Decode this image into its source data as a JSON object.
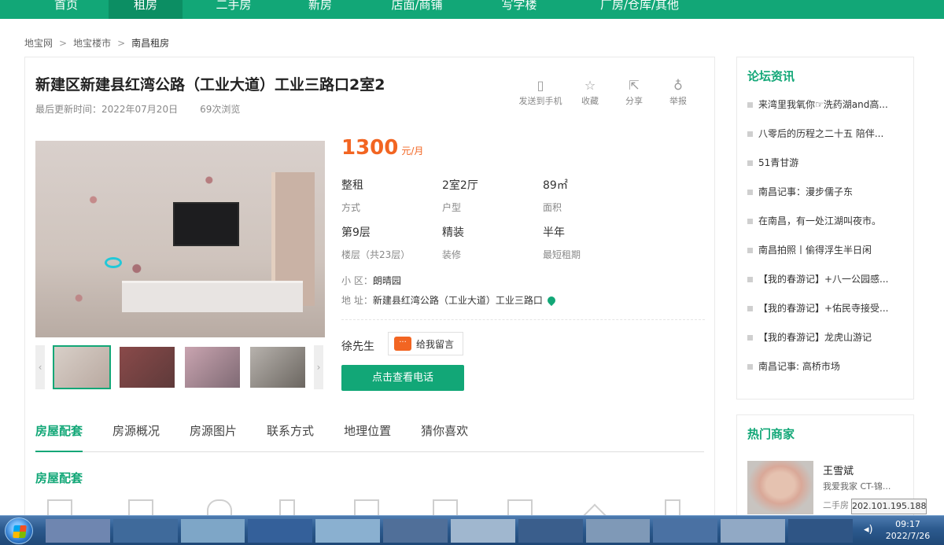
{
  "nav": {
    "items": [
      {
        "label": "首页",
        "left": 0
      },
      {
        "label": "租房",
        "left": 0
      },
      {
        "label": "二手房"
      },
      {
        "label": "新房"
      },
      {
        "label": "店面/商铺"
      },
      {
        "label": "写字楼"
      },
      {
        "label": "厂房/仓库/其他"
      }
    ]
  },
  "breadcrumb": {
    "items": [
      "地宝网",
      "地宝楼市",
      "南昌租房"
    ],
    "separator": ">"
  },
  "listing": {
    "title": "新建区新建县红湾公路（工业大道）工业三路口2室2",
    "updated": "最后更新时间：2022年07月20日",
    "views": "69次浏览",
    "actions": [
      "发送到手机",
      "收藏",
      "分享",
      "举报"
    ],
    "price": "1300",
    "price_unit": "元/月",
    "specs": [
      {
        "value": "整租",
        "label": "方式"
      },
      {
        "value": "2室2厅",
        "label": "户型"
      },
      {
        "value": "89㎡",
        "label": "面积"
      },
      {
        "value": "第9层",
        "label": "楼层（共23层）"
      },
      {
        "value": "精装",
        "label": "装修"
      },
      {
        "value": "半年",
        "label": "最短租期"
      }
    ],
    "community_label": "小 区：",
    "community": "朗晴园",
    "address_label": "地 址：",
    "address": "新建县红湾公路（工业大道）工业三路口",
    "agent": "徐先生",
    "message_button": "给我留言",
    "phone_button": "点击查看电话"
  },
  "tabs": [
    "房屋配套",
    "房源概况",
    "房源图片",
    "联系方式",
    "地理位置",
    "猜你喜欢"
  ],
  "section_title": "房屋配套",
  "sidebar": {
    "forum_title": "论坛资讯",
    "forum_items": [
      "来湾里我氧你☞洗药湖and高...",
      "八零后的历程之二十五 陪伴...",
      "51青甘游",
      "南昌记事：漫步儒子东",
      "在南昌，有一处江湖叫夜市。",
      "南昌拍照丨偷得浮生半日闲",
      "【我的春游记】+八一公园感...",
      "【我的春游记】+佑民寺接受...",
      "【我的春游记】龙虎山游记",
      "南昌记事: 高桥市场"
    ],
    "merchant_title": "热门商家",
    "merchant_name": "王雪斌",
    "merchant_desc": "我爱我家 CT-锦...",
    "merchant_type": "二手房"
  },
  "tooltip": {
    "ip": "202.101.195.188"
  },
  "taskbar": {
    "time": "09:17",
    "date": "2022/7/26"
  },
  "colors": {
    "brand": "#12a777",
    "price": "#f26522"
  }
}
